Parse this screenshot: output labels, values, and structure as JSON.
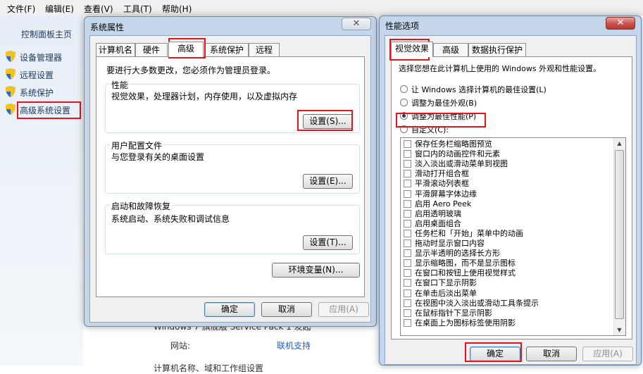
{
  "menubar": {
    "items": [
      "文件(F)",
      "编辑(E)",
      "查看(V)",
      "工具(T)",
      "帮助(H)"
    ]
  },
  "leftnav": {
    "home": "控制面板主页",
    "items": [
      "设备管理器",
      "远程设置",
      "系统保护",
      "高级系统设置"
    ]
  },
  "background": {
    "partial_text1": "Windows 7 旗舰版 Service Pack 1 发起",
    "website_label": "网站:",
    "website_link": "联机支持",
    "partial_text2": "计算机名称、域和工作组设置"
  },
  "sysprops": {
    "title": "系统属性",
    "close": "✕",
    "tabs": [
      "计算机名",
      "硬件",
      "高级",
      "系统保护",
      "远程"
    ],
    "active_tab": "高级",
    "admin_note": "要进行大多数更改，您必须作为管理员登录。",
    "perf": {
      "title": "性能",
      "desc": "视觉效果，处理器计划，内存使用，以及虚拟内存",
      "button": "设置(S)..."
    },
    "profile": {
      "title": "用户配置文件",
      "desc": "与您登录有关的桌面设置",
      "button": "设置(E)..."
    },
    "startup": {
      "title": "启动和故障恢复",
      "desc": "系统启动、系统失败和调试信息",
      "button": "设置(T)..."
    },
    "env_button": "环境变量(N)...",
    "ok": "确定",
    "cancel": "取消",
    "apply": "应用(A)"
  },
  "perfopts": {
    "title": "性能选项",
    "close": "✕",
    "tabs": [
      "视觉效果",
      "高级",
      "数据执行保护"
    ],
    "active_tab": "视觉效果",
    "intro": "选择您想在此计算机上使用的 Windows 外观和性能设置。",
    "radios": [
      {
        "label": "让 Windows 选择计算机的最佳设置(L)",
        "checked": false
      },
      {
        "label": "调整为最佳外观(B)",
        "checked": false
      },
      {
        "label": "调整为最佳性能(P)",
        "checked": true
      },
      {
        "label": "自定义(C):",
        "checked": false
      }
    ],
    "effects": [
      "保存任务栏缩略图预览",
      "窗口内的动画控件和元素",
      "淡入淡出或滑动菜单到视图",
      "滑动打开组合框",
      "平滑滚动列表框",
      "平滑屏幕字体边缘",
      "启用 Aero Peek",
      "启用透明玻璃",
      "启用桌面组合",
      "任务栏和「开始」菜单中的动画",
      "拖动时显示窗口内容",
      "显示半透明的选择长方形",
      "显示缩略图，而不是显示图标",
      "在窗口和按钮上使用视觉样式",
      "在窗口下显示阴影",
      "在单击后淡出菜单",
      "在视图中淡入淡出或滑动工具条提示",
      "在鼠标指针下显示阴影",
      "在桌面上为图标标签使用阴影"
    ],
    "ok": "确定",
    "cancel": "取消",
    "apply": "应用(A)"
  },
  "colors": {
    "highlight": "#e3141b",
    "titlebar": "#c5d6ea",
    "close_button": "#c75050",
    "link": "#1e5ebd"
  }
}
